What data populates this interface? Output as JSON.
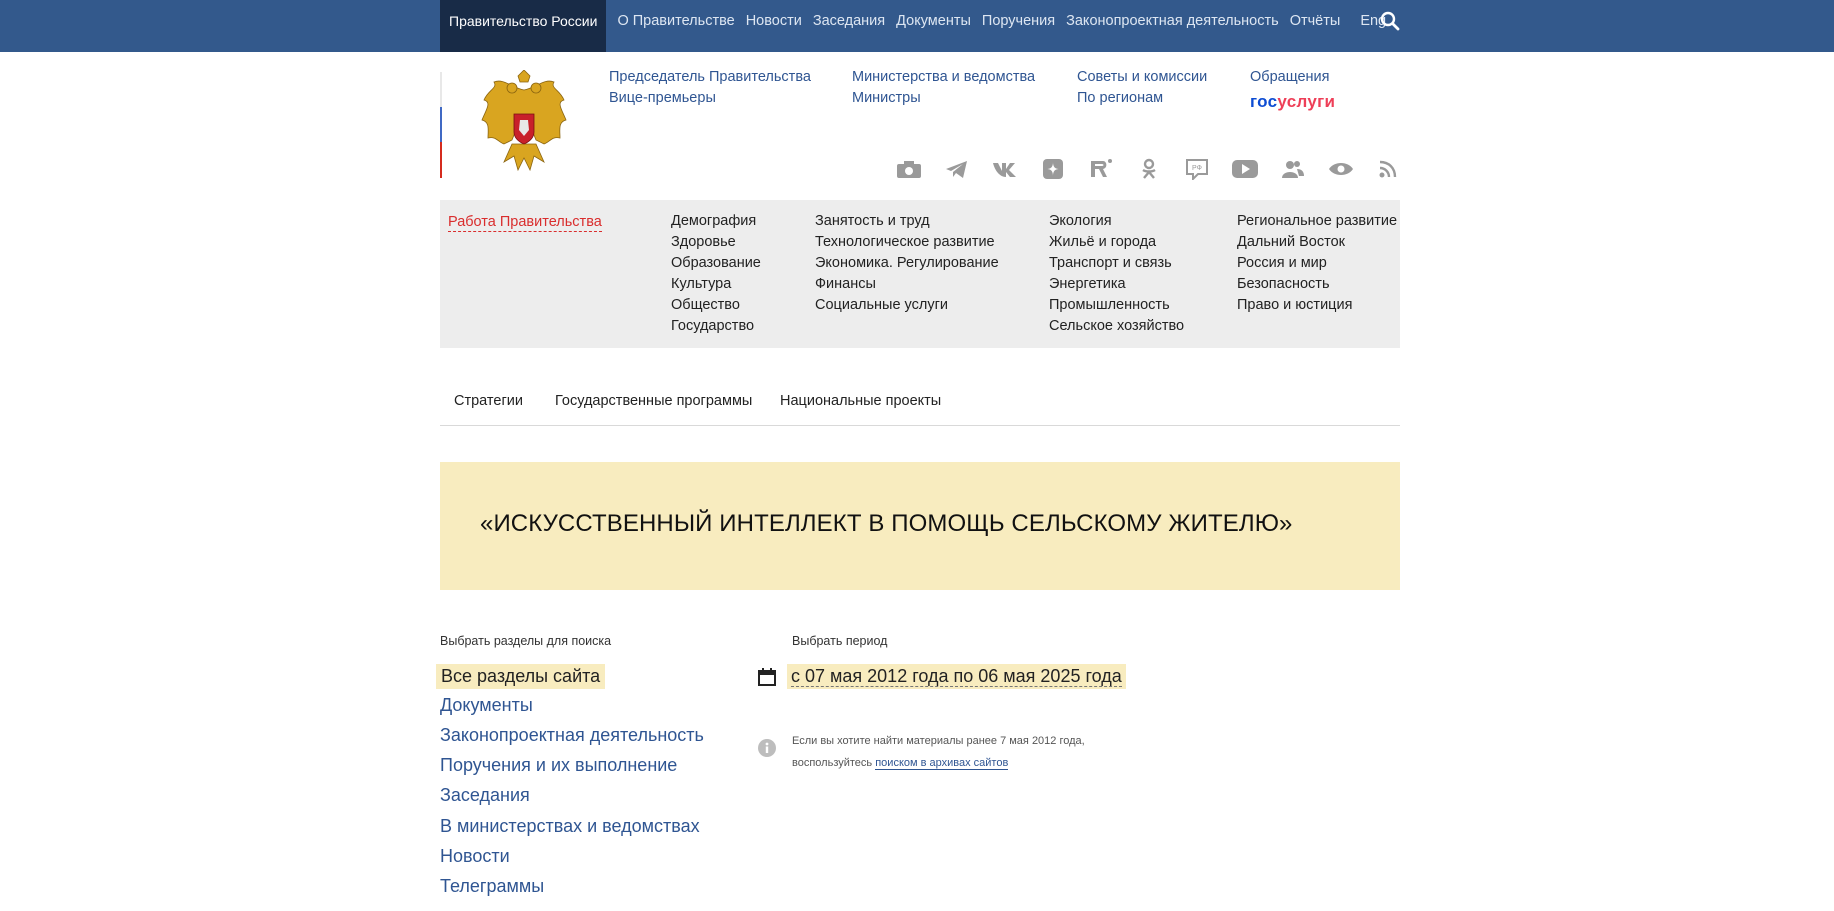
{
  "topnav": {
    "brand": "Правительство России",
    "items": [
      "О Правительстве",
      "Новости",
      "Заседания",
      "Документы",
      "Поручения",
      "Законопроектная деятельность",
      "Отчёты"
    ],
    "lang": "Eng"
  },
  "header": {
    "col1": [
      "Председатель Правительства",
      "Вице-премьеры"
    ],
    "col2": [
      "Министерства и ведомства",
      "Министры"
    ],
    "col3": [
      "Советы и комиссии",
      "По регионам"
    ],
    "col4": [
      "Обращения"
    ],
    "gosuslugi_a": "гос",
    "gosuslugi_b": "услуги"
  },
  "social_icons": [
    "camera-icon",
    "telegram-icon",
    "vk-icon",
    "dzen-icon",
    "rutube-icon",
    "odnoklassniki-icon",
    "rf-icon",
    "youtube-icon",
    "users-icon",
    "eye-icon",
    "rss-icon"
  ],
  "categories": {
    "work": "Работа Правительства",
    "col1": [
      "Демография",
      "Здоровье",
      "Образование",
      "Культура",
      "Общество",
      "Государство"
    ],
    "col2": [
      "Занятость и труд",
      "Технологическое развитие",
      "Экономика. Регулирование",
      "Финансы",
      "Социальные услуги"
    ],
    "col3": [
      "Экология",
      "Жильё и города",
      "Транспорт и связь",
      "Энергетика",
      "Промышленность",
      "Сельское хозяйство"
    ],
    "col4": [
      "Региональное развитие",
      "Дальний Восток",
      "Россия и мир",
      "Безопасность",
      "Право и юстиция"
    ]
  },
  "tabs": [
    "Стратегии",
    "Государственные программы",
    "Национальные проекты"
  ],
  "banner_title": "«ИСКУССТВЕННЫЙ ИНТЕЛЛЕКТ В ПОМОЩЬ СЕЛЬСКОМУ ЖИТЕЛЮ»",
  "search": {
    "sections_label": "Выбрать разделы для поиска",
    "sections": [
      "Все разделы сайта",
      "Документы",
      "Законопроектная деятельность",
      "Поручения и их выполнение",
      "Заседания",
      "В министерствах и ведомствах",
      "Новости",
      "Телеграммы"
    ],
    "period_label": "Выбрать период",
    "period_value": "с 07 мая 2012 года по 06 мая 2025 года",
    "note_text_1": "Если вы хотите найти материалы ранее 7 мая 2012 года,",
    "note_text_2": "воспользуйтесь ",
    "note_link": "поиском в архивах сайтов"
  },
  "colors": {
    "topbar": "#33598c",
    "brand_bg": "#182b47",
    "link": "#2f5592",
    "accent_red": "#d92d2d",
    "highlight": "#f8ecbf"
  }
}
